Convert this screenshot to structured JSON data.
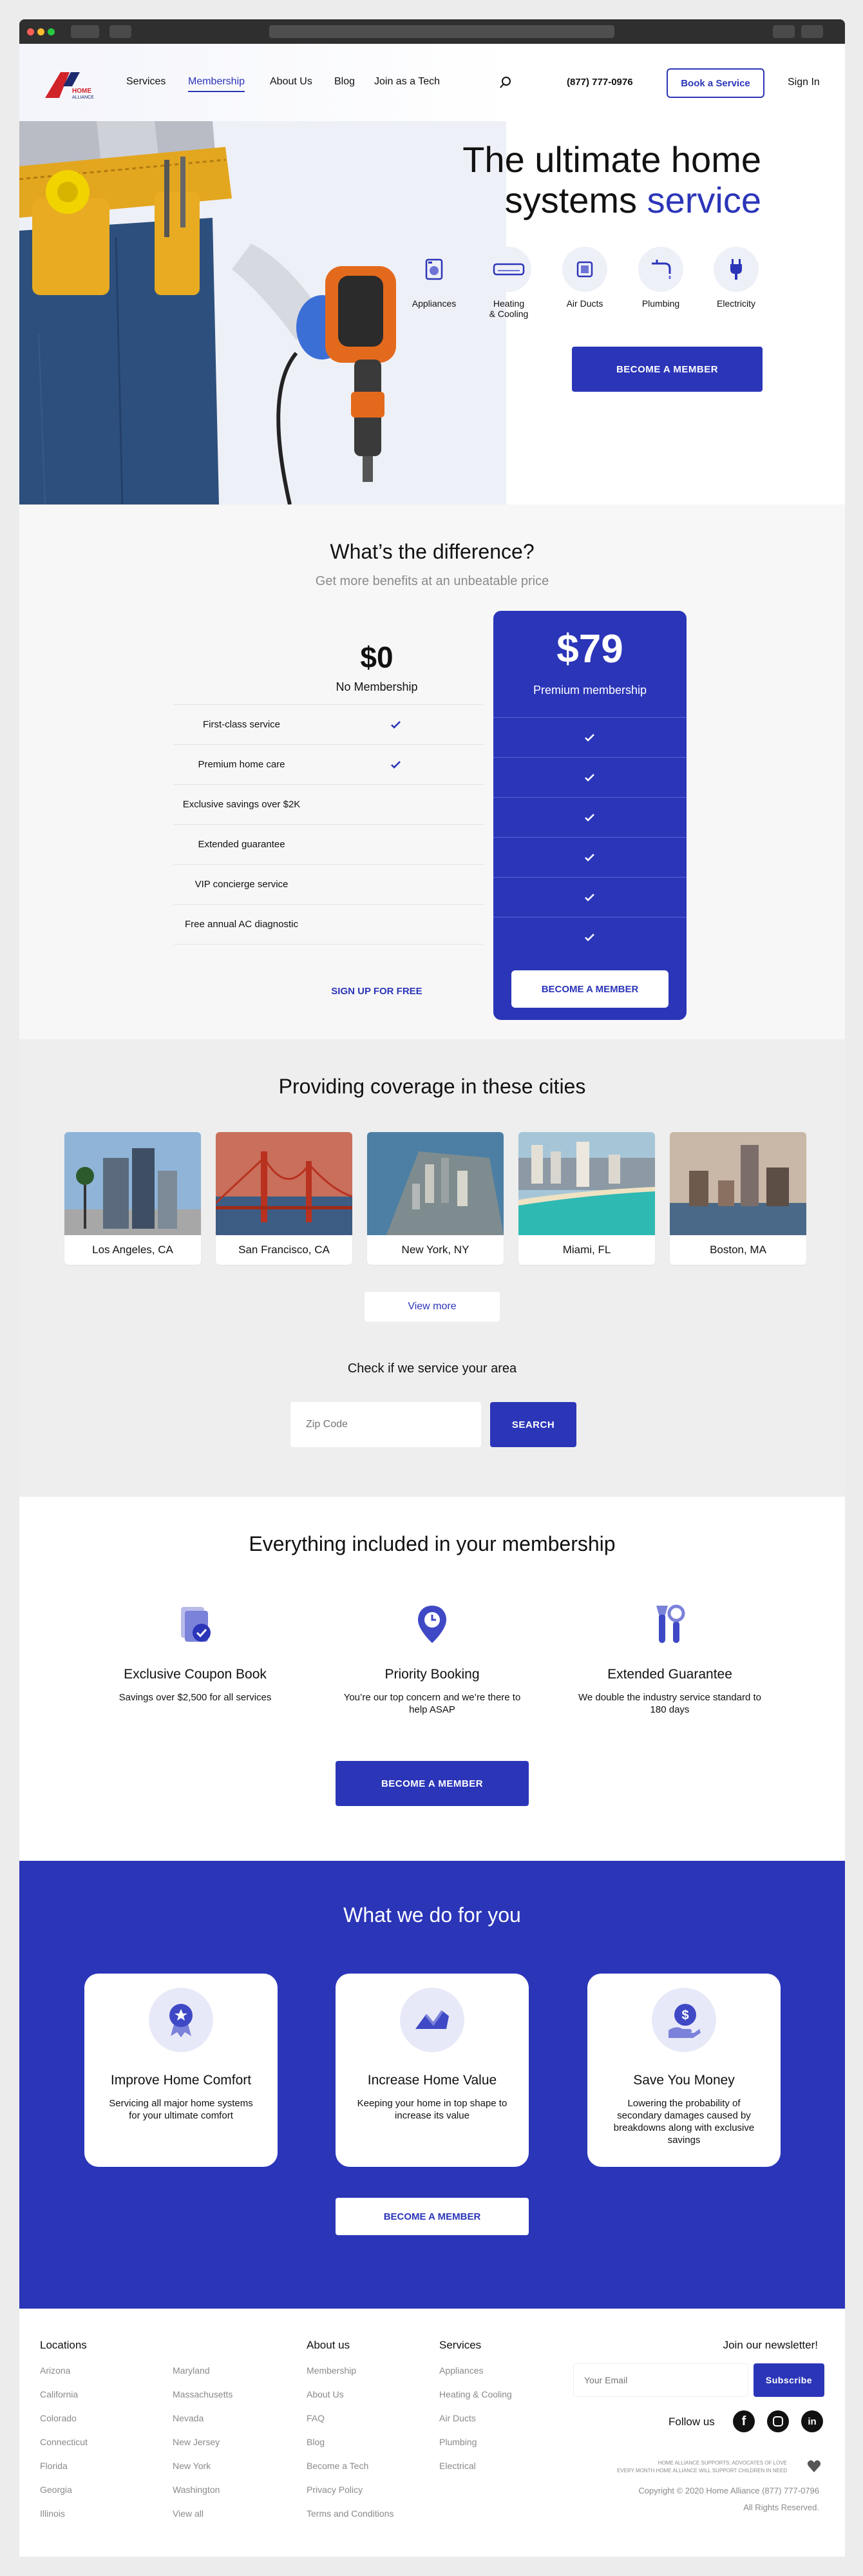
{
  "header": {
    "logo_word": "HOME",
    "logo_word2": "ALLIANCE",
    "nav": [
      "Services",
      "Membership",
      "About Us",
      "Blog",
      "Join as a Tech"
    ],
    "phone": "(877) 777-0976",
    "book_label": "Book a Service",
    "signin_label": "Sign In"
  },
  "hero": {
    "title_line1": "The ultimate home",
    "title_line2_a": "systems",
    "title_line2_b": "service",
    "services": [
      "Appliances",
      "Heating\n& Cooling",
      "Air Ducts",
      "Plumbing",
      "Electricity"
    ],
    "cta": "BECOME A MEMBER"
  },
  "compare": {
    "title": "What’s the difference?",
    "subtitle": "Get more benefits at an unbeatable price",
    "free_price": "$0",
    "free_label": "No Membership",
    "premium_price": "$79",
    "premium_label": "Premium membership",
    "features": [
      {
        "label": "First-class service",
        "free": true
      },
      {
        "label": "Premium home care",
        "free": true
      },
      {
        "label": "Exclusive savings over $2K",
        "free": false
      },
      {
        "label": "Extended guarantee",
        "free": false
      },
      {
        "label": "VIP concierge service",
        "free": false
      },
      {
        "label": "Free annual AC diagnostic",
        "free": false
      }
    ],
    "signup_free": "SIGN UP FOR FREE",
    "become_member": "BECOME A MEMBER"
  },
  "cities": {
    "title": "Providing coverage in these cities",
    "items": [
      "Los Angeles, CA",
      "San Francisco, CA",
      "New York, NY",
      "Miami, FL",
      "Boston, MA"
    ],
    "view_more": "View more",
    "check_title": "Check if we service your area",
    "zip_placeholder": "Zip Code",
    "search_label": "SEARCH"
  },
  "included": {
    "title": "Everything included in your membership",
    "items": [
      {
        "title": "Exclusive Coupon Book",
        "desc": "Savings over $2,500 for all services"
      },
      {
        "title": "Priority Booking",
        "desc": "You’re our top concern and we’re there to help ASAP"
      },
      {
        "title": "Extended Guarantee",
        "desc": "We double the industry service standard to 180 days"
      }
    ],
    "cta": "BECOME A MEMBER"
  },
  "whatwedo": {
    "title": "What we do for you",
    "items": [
      {
        "title": "Improve Home Comfort",
        "desc": "Servicing all major home systems for your ultimate comfort"
      },
      {
        "title": "Increase Home Value",
        "desc": "Keeping your home in top shape to increase its value"
      },
      {
        "title": "Save You Money",
        "desc": "Lowering the probability of secondary damages caused by breakdowns along with exclusive savings"
      }
    ],
    "cta": "BECOME A MEMBER"
  },
  "footer": {
    "locations_title": "Locations",
    "locations_col1": [
      "Arizona",
      "California",
      "Colorado",
      "Connecticut",
      "Florida",
      "Georgia",
      "Illinois"
    ],
    "locations_col2": [
      "Maryland",
      "Massachusetts",
      "Nevada",
      "New Jersey",
      "New York",
      "Washington",
      "View all"
    ],
    "about_title": "About us",
    "about_links": [
      "Membership",
      "About Us",
      "FAQ",
      "Blog",
      "Become a Tech",
      "Privacy Policy",
      "Terms and Conditions"
    ],
    "services_title": "Services",
    "services_links": [
      "Appliances",
      "Heating & Cooling",
      "Air Ducts",
      "Plumbing",
      "Electrical"
    ],
    "newsletter_title": "Join our newsletter!",
    "email_placeholder": "Your Email",
    "subscribe_label": "Subscribe",
    "follow_label": "Follow us",
    "support_line1": "HOME ALLIANCE SUPPORTS: ADVOCATES OF LOVE",
    "support_line2": "EVERY MONTH HOME ALLIANCE WILL SUPPORT CHILDREN IN NEED",
    "copyright": "Copyright © 2020 Home Alliance (877) 777-0796",
    "rights": "All Rights Reserved."
  },
  "colors": {
    "accent": "#2b35b8",
    "logo_red": "#d1232a"
  }
}
